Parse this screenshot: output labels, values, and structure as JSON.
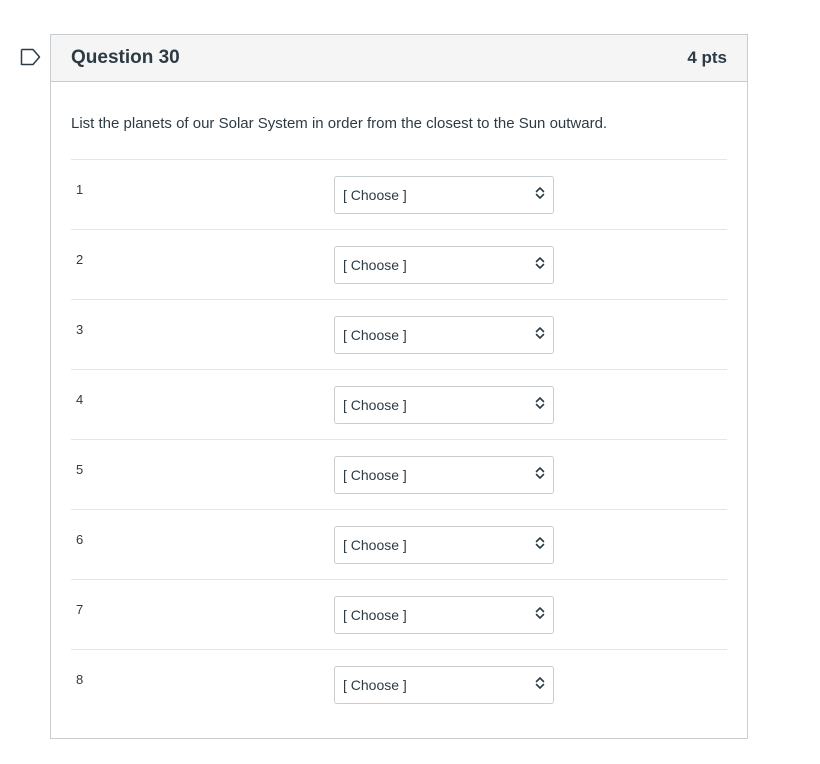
{
  "question": {
    "title": "Question 30",
    "points": "4 pts",
    "text": "List the planets of our Solar System in order from the closest to the Sun outward."
  },
  "rows": [
    {
      "number": "1",
      "selected": "[ Choose ]"
    },
    {
      "number": "2",
      "selected": "[ Choose ]"
    },
    {
      "number": "3",
      "selected": "[ Choose ]"
    },
    {
      "number": "4",
      "selected": "[ Choose ]"
    },
    {
      "number": "5",
      "selected": "[ Choose ]"
    },
    {
      "number": "6",
      "selected": "[ Choose ]"
    },
    {
      "number": "7",
      "selected": "[ Choose ]"
    },
    {
      "number": "8",
      "selected": "[ Choose ]"
    }
  ],
  "icons": {
    "flag": "flag-question-icon",
    "select_arrow": "chevron-updown-icon"
  }
}
